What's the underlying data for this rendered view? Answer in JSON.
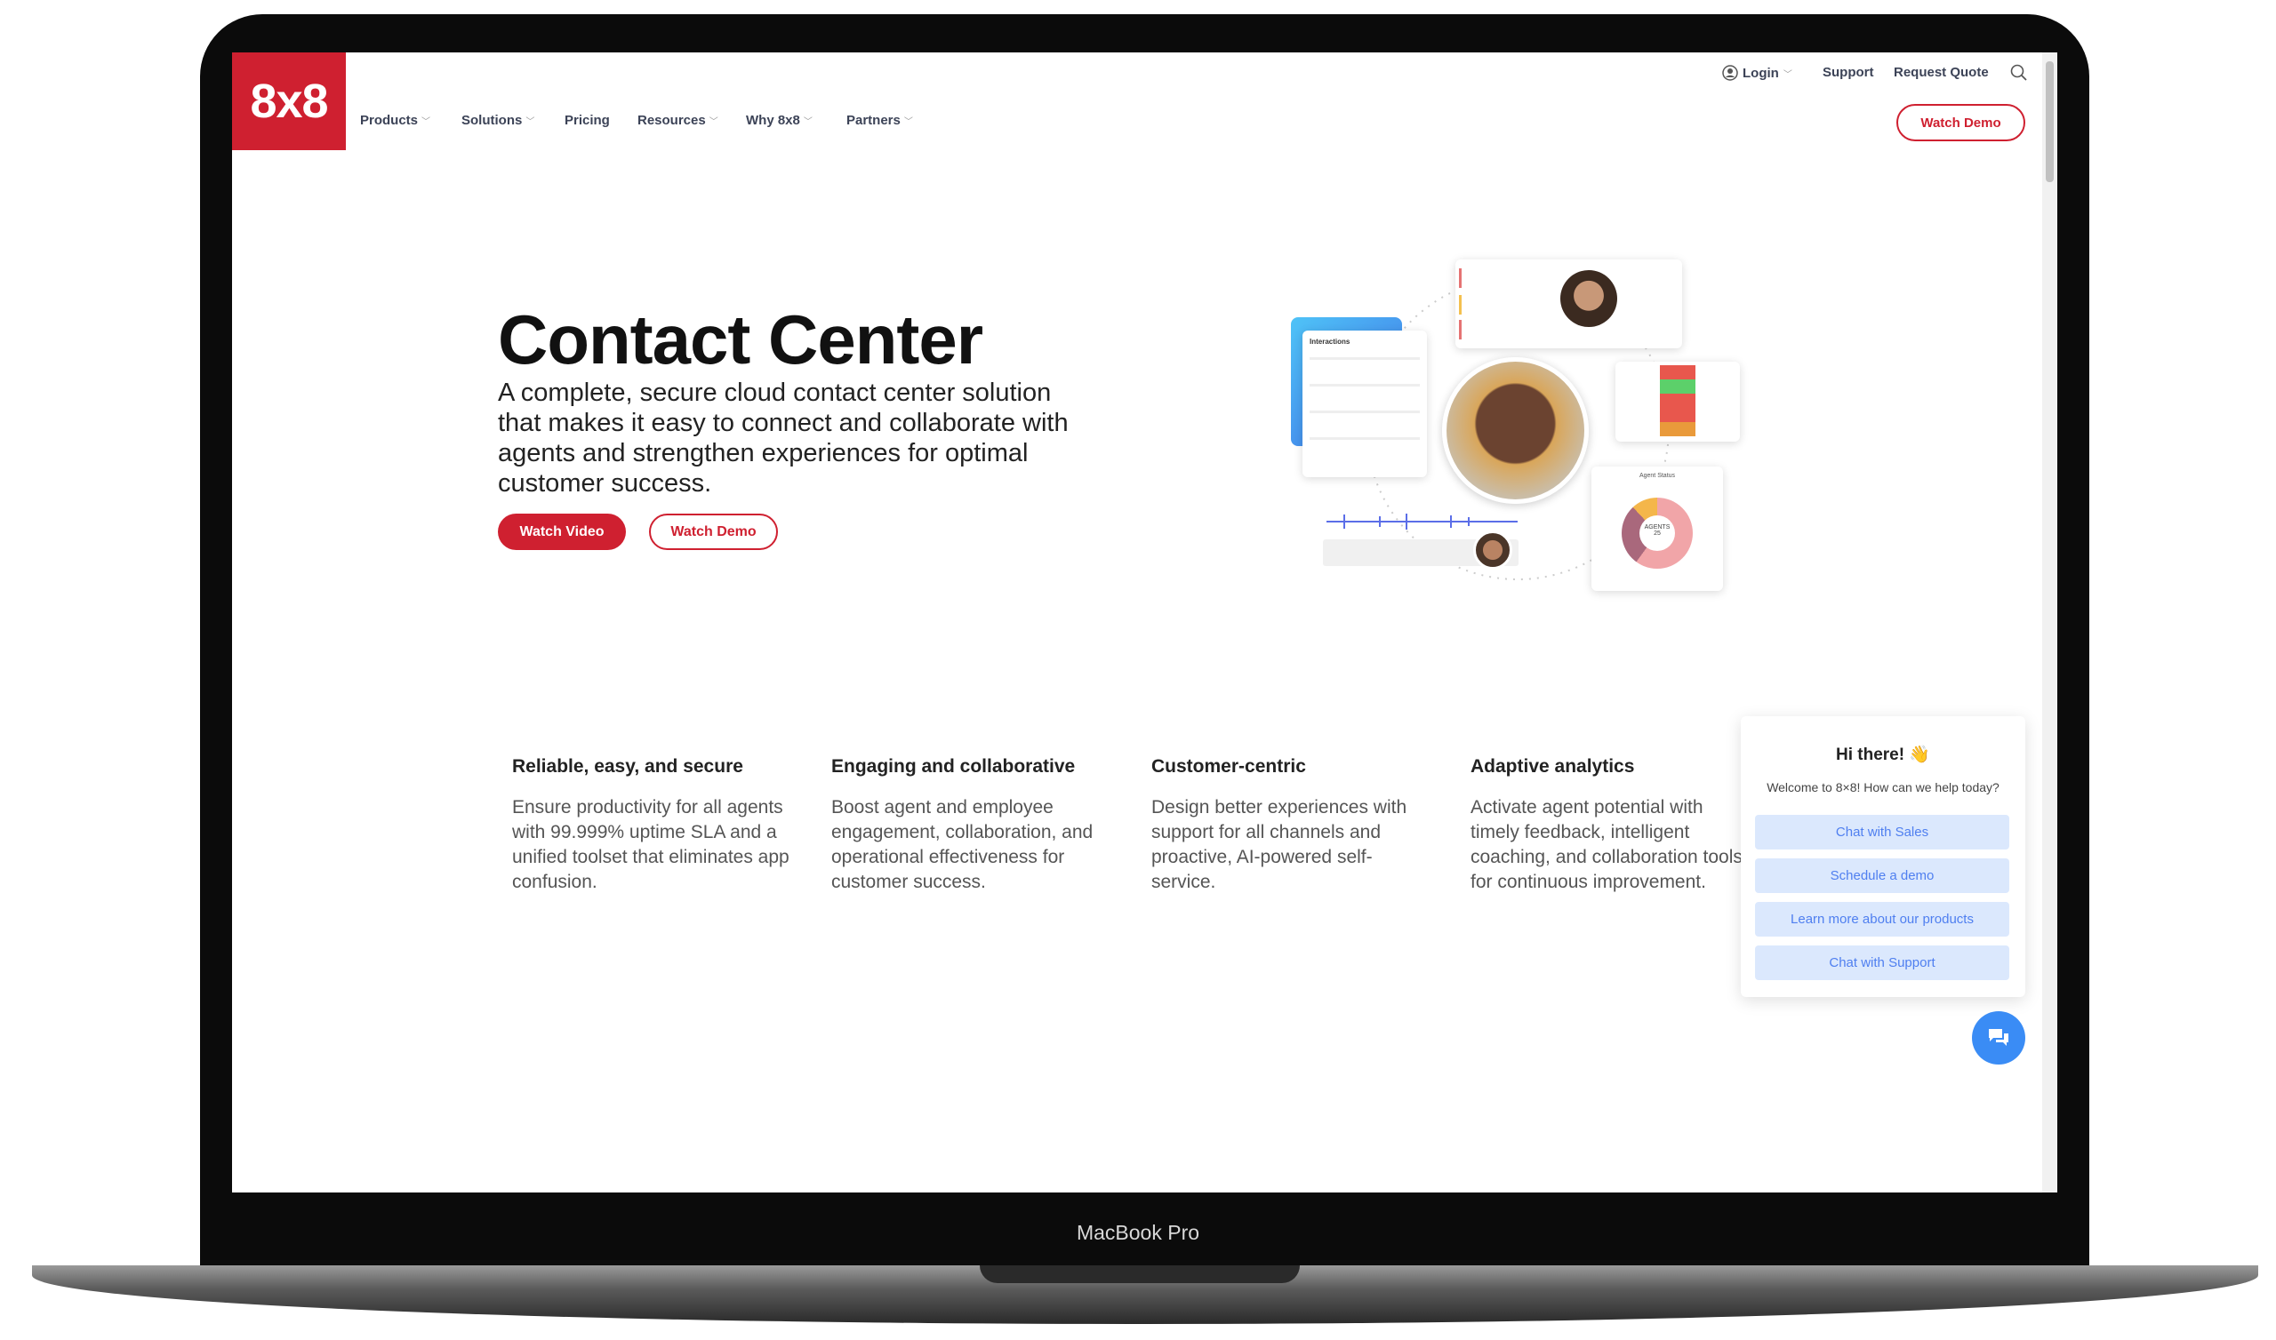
{
  "device_label": "MacBook Pro",
  "colors": {
    "brand": "#cf2030",
    "chat_accent": "#3a8cf5",
    "chat_button_bg": "#dbe8fd"
  },
  "header": {
    "logo": "8x8",
    "nav": [
      {
        "label": "Products",
        "dropdown": true
      },
      {
        "label": "Solutions",
        "dropdown": true
      },
      {
        "label": "Pricing",
        "dropdown": false
      },
      {
        "label": "Resources",
        "dropdown": true
      },
      {
        "label": "Why 8x8",
        "dropdown": true
      },
      {
        "label": "Partners",
        "dropdown": true
      }
    ],
    "utility": {
      "login": "Login",
      "support": "Support",
      "request_quote": "Request Quote",
      "search_icon": "search-icon",
      "user_icon": "user-circle-icon"
    },
    "watch_demo": "Watch Demo"
  },
  "hero": {
    "title": "Contact Center",
    "subtitle": "A complete, secure cloud contact center solution that makes it easy to connect and collaborate with agents and strengthen experiences for optimal customer success.",
    "watch_video": "Watch Video",
    "watch_demo": "Watch Demo",
    "illustration": {
      "interactions_title": "Interactions",
      "agent_status_title": "Agent Status",
      "donut_label": "AGENTS",
      "donut_value": "25"
    }
  },
  "features": [
    {
      "title": "Reliable, easy, and secure",
      "body": "Ensure productivity for all agents with 99.999% uptime SLA and a unified toolset that eliminates app confusion."
    },
    {
      "title": "Engaging and collaborative",
      "body": "Boost agent and employee engagement, collaboration, and operational effectiveness for customer success."
    },
    {
      "title": "Customer-centric",
      "body": "Design better experiences with support for all channels and proactive, AI-powered self-service."
    },
    {
      "title": "Adaptive analytics",
      "body": "Activate agent potential with timely feedback, intelligent coaching, and collaboration tools for continuous improvement."
    }
  ],
  "chat_widget": {
    "greeting": "Hi there! 👋",
    "welcome": "Welcome to 8×8! How can we help today?",
    "options": [
      "Chat with Sales",
      "Schedule a demo",
      "Learn more about our products",
      "Chat with Support"
    ],
    "launcher_icon": "chat-bubbles-icon"
  }
}
